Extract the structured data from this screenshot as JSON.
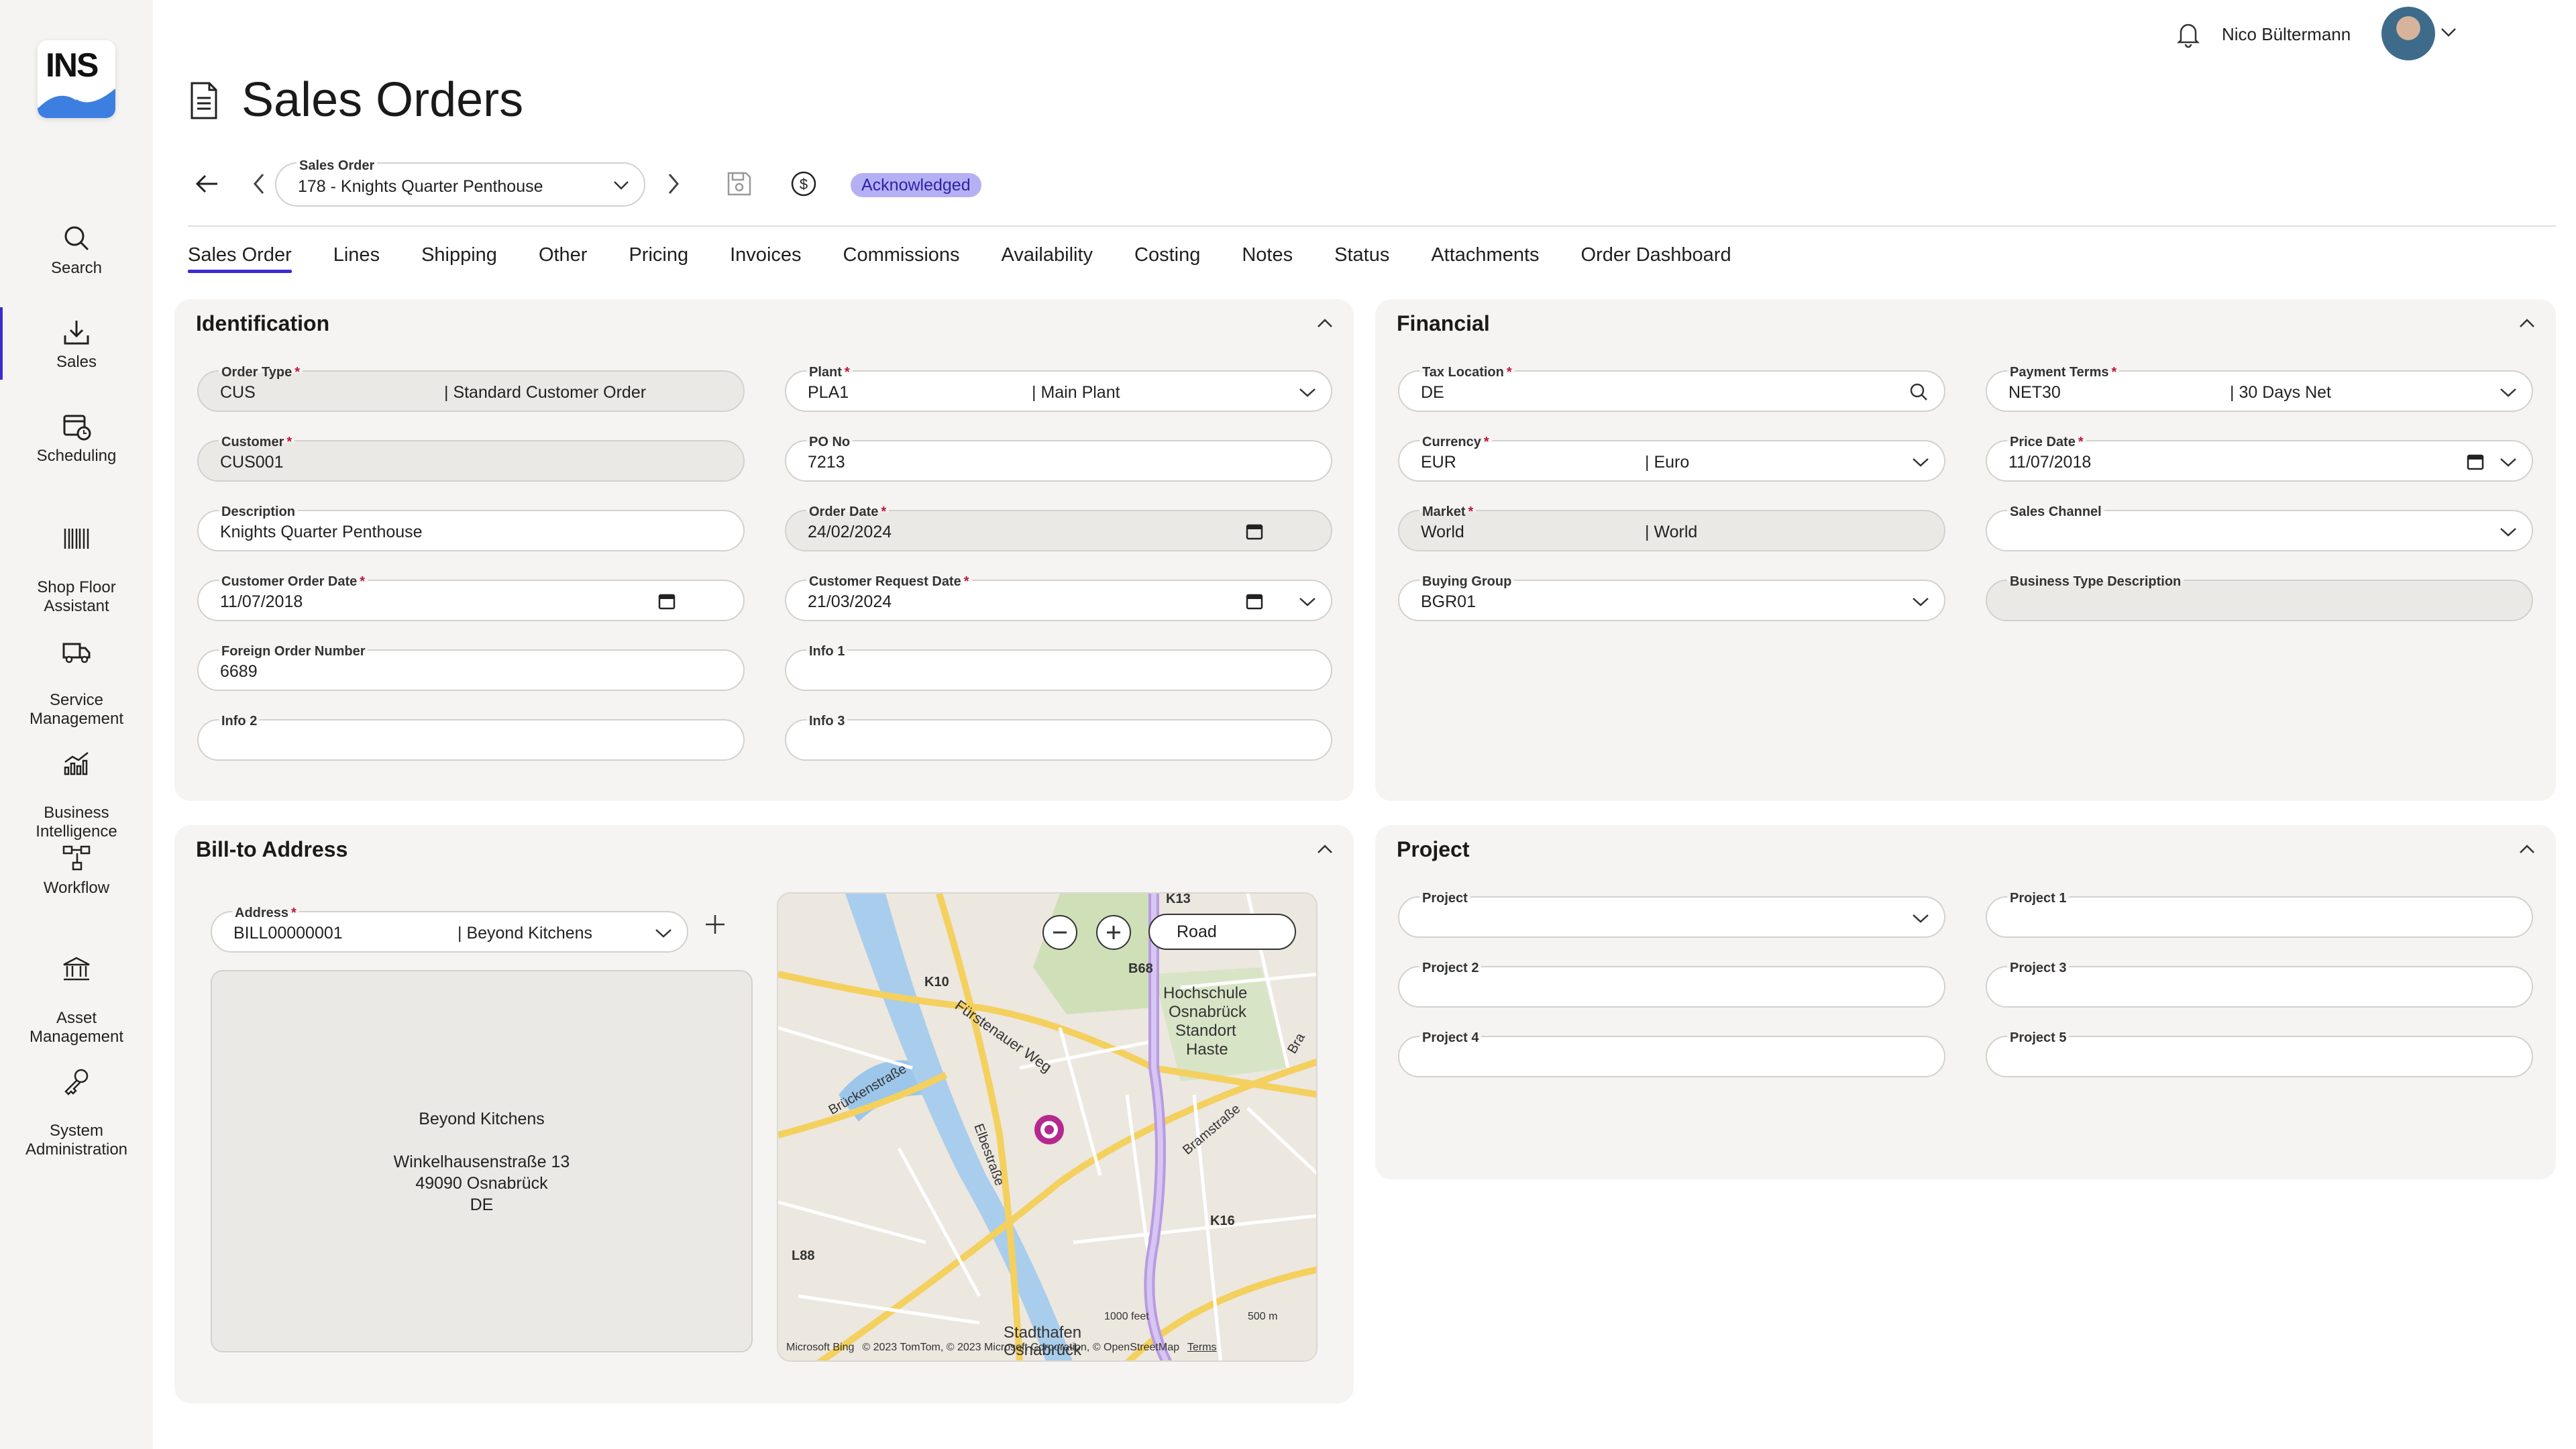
{
  "app": {
    "logo_text": "INS",
    "title": "Sales Orders"
  },
  "user": {
    "name": "Nico Bültermann"
  },
  "sidebar": {
    "items": [
      {
        "label": "Search",
        "icon": "search-icon"
      },
      {
        "label": "Sales",
        "icon": "sales-download-icon",
        "active": true
      },
      {
        "label": "Scheduling",
        "icon": "calendar-clock-icon"
      },
      {
        "label": "Shop Floor\nAssistant",
        "icon": "barcode-icon"
      },
      {
        "label": "Service\nManagement",
        "icon": "service-truck-icon"
      },
      {
        "label": "Business\nIntelligence",
        "icon": "chart-icon"
      },
      {
        "label": "Workflow",
        "icon": "workflow-icon"
      },
      {
        "label": "Asset\nManagement",
        "icon": "bank-icon"
      },
      {
        "label": "System\nAdministration",
        "icon": "wrench-key-icon"
      }
    ]
  },
  "toolbar": {
    "sales_order_label": "Sales Order",
    "sales_order_value": "178 - Knights Quarter Penthouse",
    "status": "Acknowledged"
  },
  "tabs": [
    "Sales Order",
    "Lines",
    "Shipping",
    "Other",
    "Pricing",
    "Invoices",
    "Commissions",
    "Availability",
    "Costing",
    "Notes",
    "Status",
    "Attachments",
    "Order Dashboard"
  ],
  "identification": {
    "title": "Identification",
    "order_type": {
      "label": "Order Type",
      "code": "CUS",
      "desc": "| Standard Customer Order"
    },
    "plant": {
      "label": "Plant",
      "code": "PLA1",
      "desc": "| Main Plant"
    },
    "customer": {
      "label": "Customer",
      "value": "CUS001"
    },
    "po_no": {
      "label": "PO No",
      "value": "7213"
    },
    "description": {
      "label": "Description",
      "value": "Knights Quarter Penthouse"
    },
    "order_date": {
      "label": "Order Date",
      "value": "24/02/2024"
    },
    "customer_order_date": {
      "label": "Customer Order Date",
      "value": "11/07/2018"
    },
    "customer_request_date": {
      "label": "Customer Request Date",
      "value": "21/03/2024"
    },
    "foreign_order_number": {
      "label": "Foreign Order Number",
      "value": "6689"
    },
    "info1": {
      "label": "Info 1",
      "value": ""
    },
    "info2": {
      "label": "Info 2",
      "value": ""
    },
    "info3": {
      "label": "Info 3",
      "value": ""
    }
  },
  "financial": {
    "title": "Financial",
    "tax_location": {
      "label": "Tax Location",
      "value": "DE"
    },
    "payment_terms": {
      "label": "Payment Terms",
      "code": "NET30",
      "desc": "| 30 Days Net"
    },
    "currency": {
      "label": "Currency",
      "code": "EUR",
      "desc": "| Euro"
    },
    "price_date": {
      "label": "Price Date",
      "value": "11/07/2018"
    },
    "market": {
      "label": "Market",
      "code": "World",
      "desc": "| World"
    },
    "sales_channel": {
      "label": "Sales Channel",
      "value": ""
    },
    "buying_group": {
      "label": "Buying Group",
      "value": "BGR01"
    },
    "business_type_description": {
      "label": "Business Type Description",
      "value": ""
    }
  },
  "bill_to": {
    "title": "Bill-to Address",
    "address": {
      "label": "Address",
      "code": "BILL00000001",
      "desc": "| Beyond Kitchens"
    },
    "card": {
      "name": "Beyond Kitchens",
      "street": "Winkelhausenstraße 13",
      "city": "49090 Osnabrück",
      "country": "DE"
    },
    "map": {
      "style": "Road",
      "labels": [
        "K13",
        "B68",
        "K10",
        "Hochschule",
        "Osnabrück",
        "Standort",
        "Haste",
        "Fürstenauer Weg",
        "Bramstraße",
        "Brückenstraße",
        "Elbestraße",
        "K16",
        "L88",
        "Stadthafen",
        "Osnabrück",
        "Bra"
      ],
      "scale_feet": "1000 feet",
      "scale_m": "500 m",
      "provider": "Microsoft Bing",
      "copyright": "© 2023 TomTom, © 2023 Microsoft Corporation, © OpenStreetMap",
      "terms": "Terms"
    }
  },
  "project": {
    "title": "Project",
    "project": {
      "label": "Project",
      "value": ""
    },
    "project1": {
      "label": "Project 1",
      "value": ""
    },
    "project2": {
      "label": "Project 2",
      "value": ""
    },
    "project3": {
      "label": "Project 3",
      "value": ""
    },
    "project4": {
      "label": "Project 4",
      "value": ""
    },
    "project5": {
      "label": "Project 5",
      "value": ""
    }
  },
  "colors": {
    "accent": "#3a2bd1",
    "badge_bg": "#b5b0f3",
    "panel_bg": "#f5f4f2",
    "required": "#c0143c"
  }
}
